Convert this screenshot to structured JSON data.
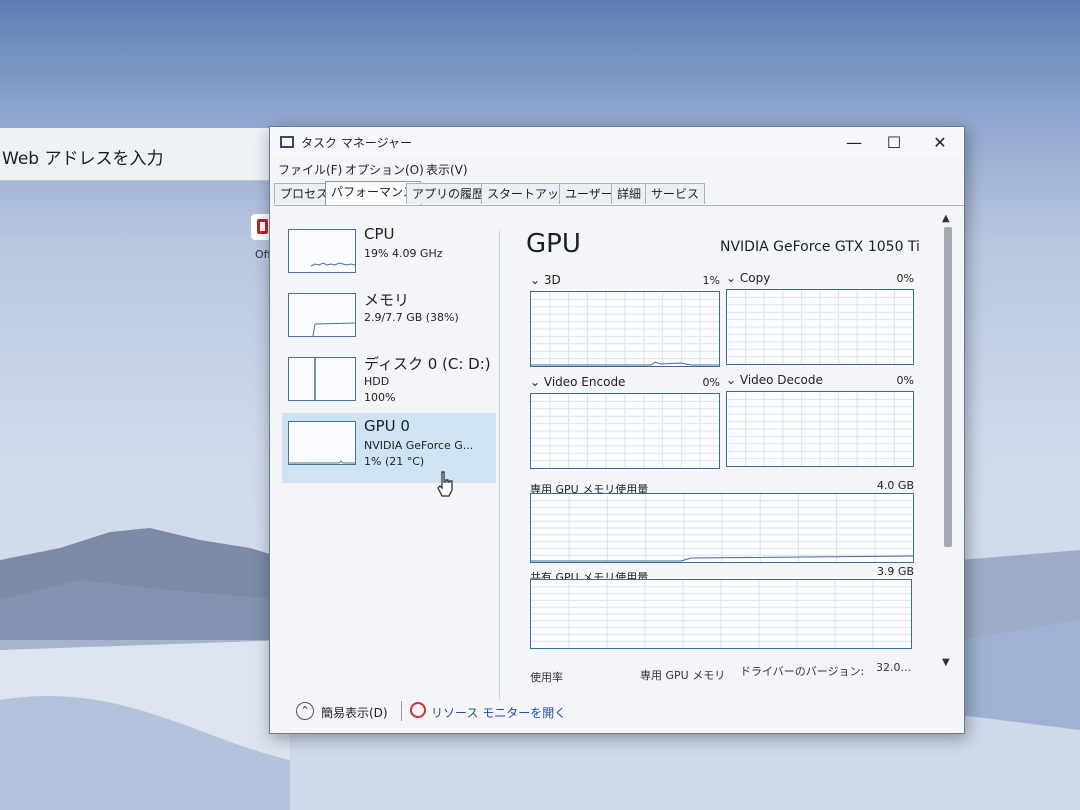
{
  "desktop": {
    "browser_address_placeholder": "Web アドレスを入力",
    "icon_label": "Off"
  },
  "window": {
    "title": "タスク マネージャー",
    "controls": {
      "minimize": "—",
      "maximize": "☐",
      "close": "✕"
    }
  },
  "menu": [
    "ファイル(F)",
    "オプション(O)",
    "表示(V)"
  ],
  "tabs": [
    {
      "label": "プロセス",
      "active": false
    },
    {
      "label": "パフォーマンス",
      "active": true
    },
    {
      "label": "アプリの履歴",
      "active": false
    },
    {
      "label": "スタートアップ",
      "active": false
    },
    {
      "label": "ユーザー",
      "active": false
    },
    {
      "label": "詳細",
      "active": false
    },
    {
      "label": "サービス",
      "active": false
    }
  ],
  "resources": [
    {
      "name": "CPU",
      "line1": "19% 4.09 GHz",
      "line2": ""
    },
    {
      "name": "メモリ",
      "line1": "2.9/7.7 GB (38%)",
      "line2": ""
    },
    {
      "name": "ディスク 0 (C: D:)",
      "line1": "HDD",
      "line2": "100%"
    },
    {
      "name": "GPU 0",
      "line1": "NVIDIA GeForce G...",
      "line2": "1% (21 °C)",
      "selected": true
    }
  ],
  "gpu": {
    "title": "GPU",
    "model": "NVIDIA GeForce GTX 1050 Ti",
    "engines": [
      {
        "label": "3D",
        "value": "1%"
      },
      {
        "label": "Copy",
        "value": "0%"
      },
      {
        "label": "Video Encode",
        "value": "0%"
      },
      {
        "label": "Video Decode",
        "value": "0%"
      }
    ],
    "dedicated": {
      "label": "専用 GPU メモリ使用量",
      "max": "4.0 GB"
    },
    "shared": {
      "label": "共有 GPU メモリ使用量",
      "max": "3.9 GB"
    },
    "bottom_stats": {
      "utilization": "使用率",
      "dedicated_memory": "専用 GPU メモリ",
      "driver_version_label": "ドライバーのバージョン:",
      "driver_version": "32.0..."
    }
  },
  "footer": {
    "simple_view": "簡易表示(D)",
    "resource_monitor": "リソース モニターを開く"
  }
}
